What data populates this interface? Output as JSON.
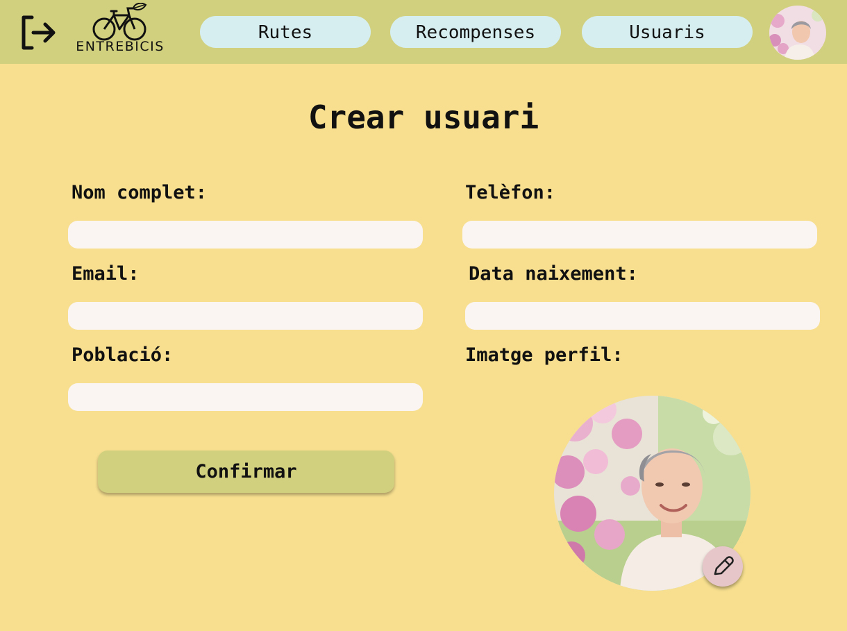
{
  "app": {
    "logo_text": "ENTREBICIS"
  },
  "nav": {
    "items": [
      {
        "label": "Rutes"
      },
      {
        "label": "Recompenses"
      },
      {
        "label": "Usuaris"
      }
    ]
  },
  "page": {
    "title": "Crear usuari"
  },
  "form": {
    "full_name": {
      "label": "Nom complet:",
      "value": ""
    },
    "phone": {
      "label": "Telèfon:",
      "value": ""
    },
    "email": {
      "label": "Email:",
      "value": ""
    },
    "birth_date": {
      "label": "Data naixement:",
      "value": ""
    },
    "town": {
      "label": "Població:",
      "value": ""
    },
    "profile_image": {
      "label": "Imatge perfil:"
    },
    "confirm_label": "Confirmar"
  },
  "colors": {
    "background": "#f7df8f",
    "topbar": "#d1d07e",
    "nav_button": "#d6eef0",
    "input": "#faf5f3",
    "edit_button": "#e7c6c9"
  },
  "icons": [
    "logout-icon",
    "bicycle-logo-icon",
    "pencil-icon"
  ]
}
